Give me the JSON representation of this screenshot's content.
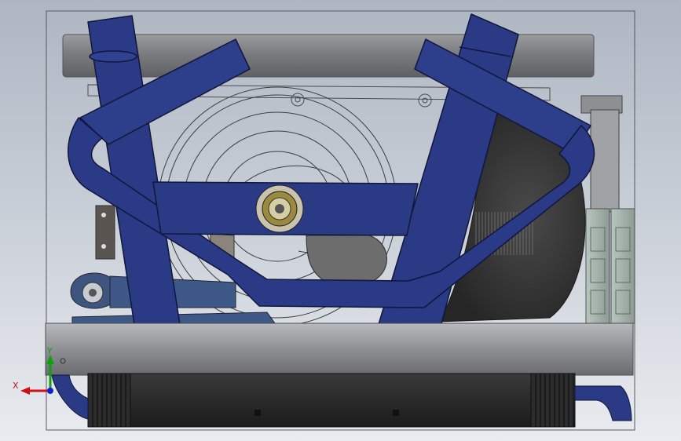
{
  "viewport": {
    "background_top": "#aeb6c2",
    "background_bottom": "#e9ecf0"
  },
  "model": {
    "tube_color": "#2a3a84",
    "frame_color": "#8a8c90",
    "flywheel_color": "#3a3a3a",
    "belt_color": "#2a2a2a"
  },
  "triad": {
    "x_label": "X",
    "y_label": "Y",
    "x_color": "#d01010",
    "y_color": "#10a010",
    "z_color": "#1020d0"
  }
}
